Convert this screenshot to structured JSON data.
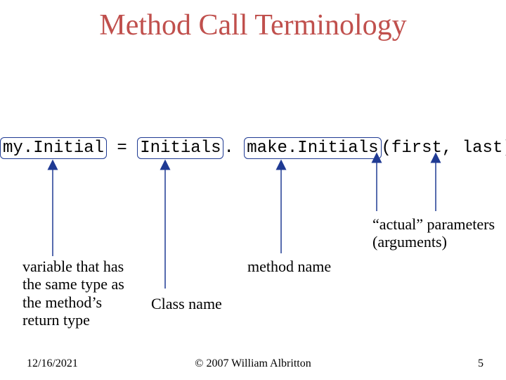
{
  "title": "Method Call Terminology",
  "code": {
    "var": "my.Initial",
    "eq": " = ",
    "cls": "Initials",
    "dot": ". ",
    "method": "make.Initials",
    "args": "(first, last);"
  },
  "annotations": {
    "actual1": "“actual” parameters",
    "actual2": "(arguments)",
    "methodName": "method name",
    "className": "Class name",
    "variable1": "variable that has",
    "variable2": "the same type as",
    "variable3": "the method’s",
    "variable4": "return type"
  },
  "footer": {
    "date": "12/16/2021",
    "copyright": "© 2007 William Albritton",
    "pagenum": "5"
  },
  "colors": {
    "title": "#c0504d",
    "arrow": "#1f3a93",
    "box": "#1f3a93"
  }
}
